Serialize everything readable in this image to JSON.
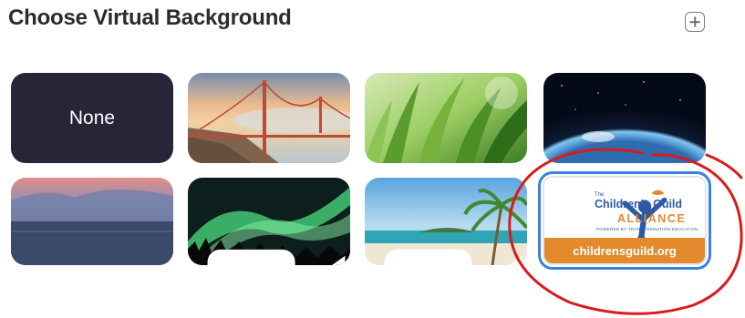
{
  "header": {
    "title": "Choose Virtual Background"
  },
  "tiles": {
    "none_label": "None"
  },
  "logo": {
    "the": "The",
    "name": "Children's Guild",
    "alliance": "ALLIANCE",
    "tagline": "POWERED BY TRANSFORMATION EDUCATION",
    "url": "childrensguild.org"
  },
  "colors": {
    "selection_border": "#3b82e0",
    "annotation_circle": "#d81c1c",
    "none_tile": "#272538",
    "logo_blue": "#2d5aa3",
    "logo_orange": "#e38a2c"
  },
  "icons": [
    "add-icon",
    "video-camera-icon"
  ]
}
